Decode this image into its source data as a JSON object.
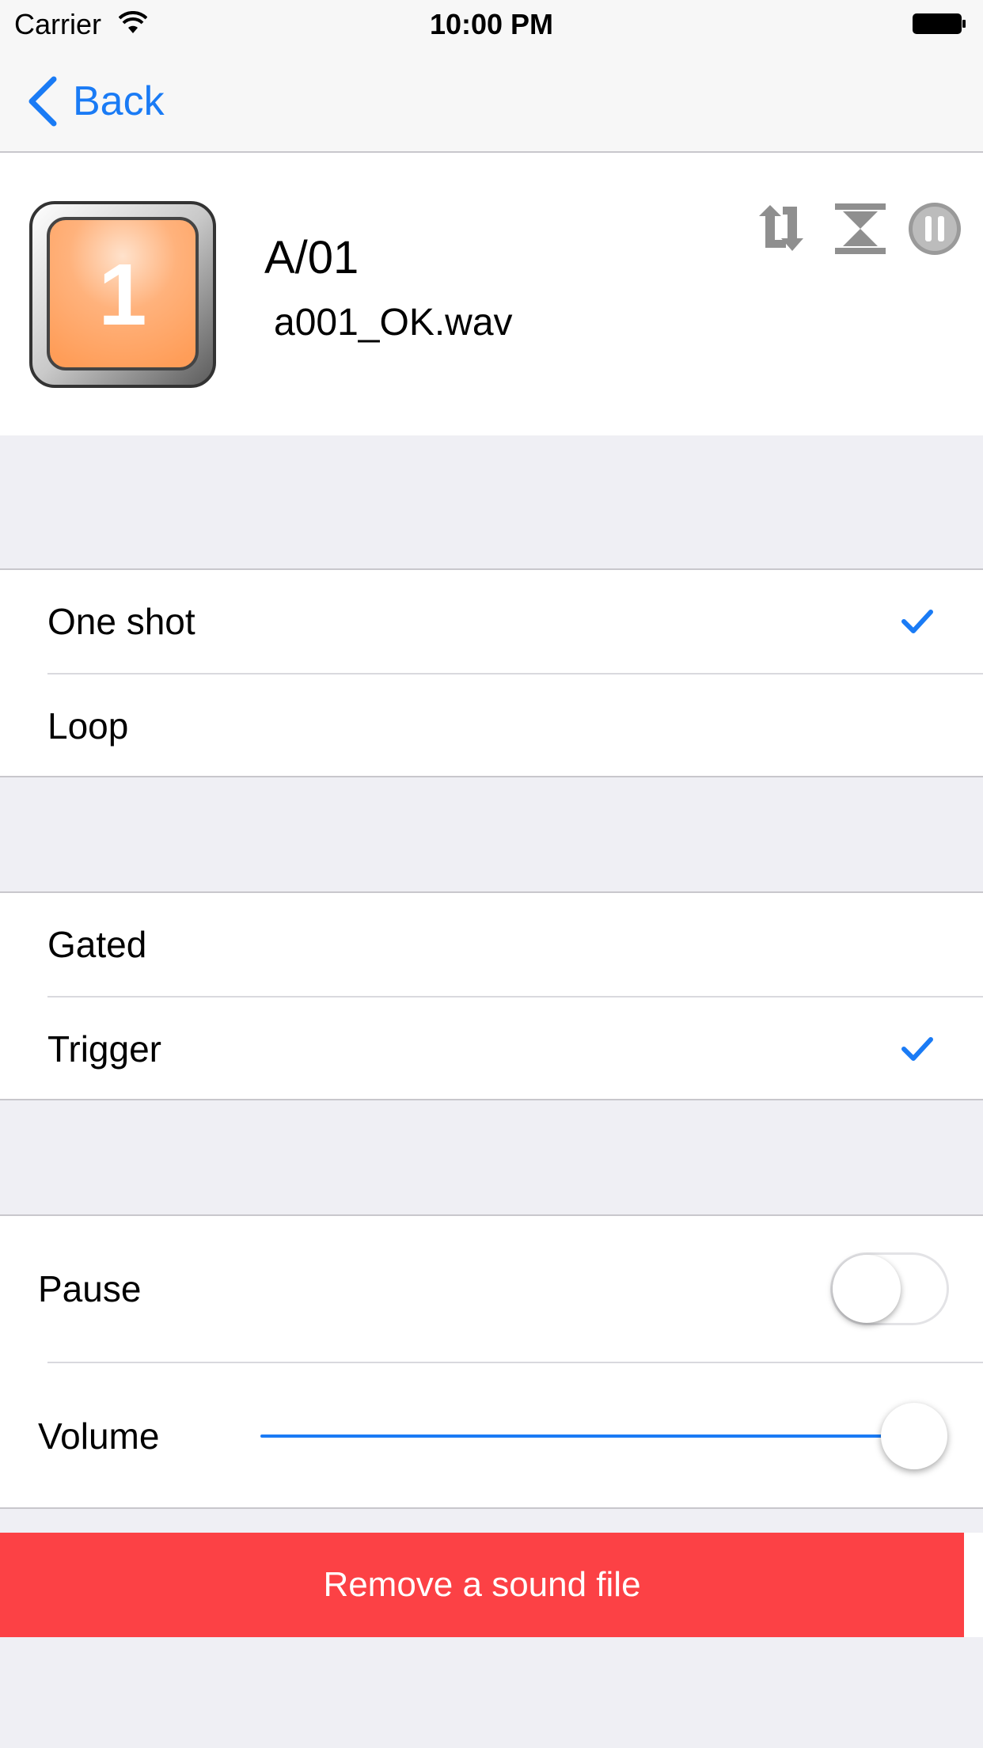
{
  "status_bar": {
    "carrier": "Carrier",
    "time": "10:00 PM"
  },
  "nav": {
    "back_label": "Back"
  },
  "pad": {
    "number": "1",
    "title": "A/01",
    "filename": " a001_OK.wav",
    "tile_color": "#ffa566"
  },
  "header_icons": [
    "swap-icon",
    "align-center-icon",
    "pause-circle-icon"
  ],
  "play_mode": {
    "options": [
      "One shot",
      "Loop"
    ],
    "selected": "One shot"
  },
  "trigger_mode": {
    "options": [
      "Gated",
      "Trigger"
    ],
    "selected": "Trigger"
  },
  "settings": {
    "pause_label": "Pause",
    "pause_on": false,
    "volume_label": "Volume",
    "volume_fraction": 1.0
  },
  "remove_button": {
    "label": "Remove a sound file"
  },
  "colors": {
    "accent": "#1a7bf5",
    "danger": "#fc4145",
    "background": "#efeff4"
  }
}
